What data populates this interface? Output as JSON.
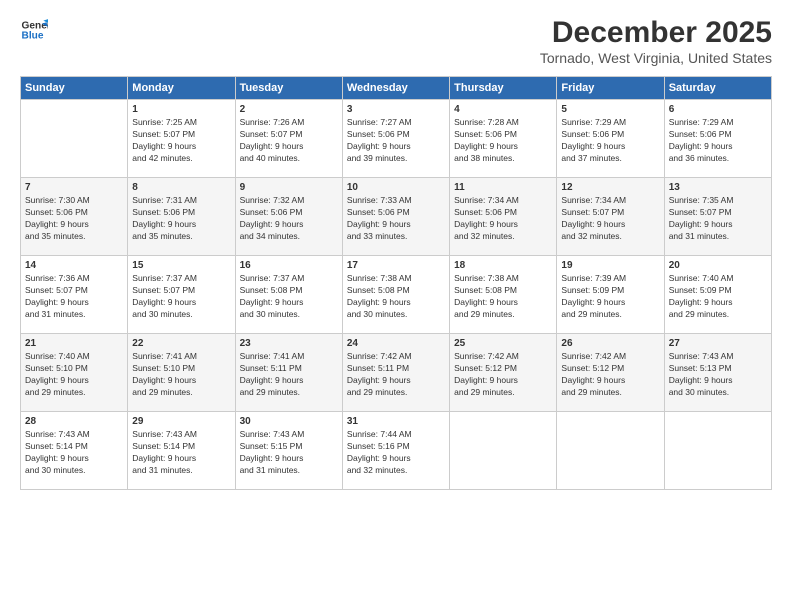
{
  "logo": {
    "line1": "General",
    "line2": "Blue"
  },
  "title": "December 2025",
  "subtitle": "Tornado, West Virginia, United States",
  "header_days": [
    "Sunday",
    "Monday",
    "Tuesday",
    "Wednesday",
    "Thursday",
    "Friday",
    "Saturday"
  ],
  "weeks": [
    [
      {
        "num": "",
        "detail": ""
      },
      {
        "num": "1",
        "detail": "Sunrise: 7:25 AM\nSunset: 5:07 PM\nDaylight: 9 hours\nand 42 minutes."
      },
      {
        "num": "2",
        "detail": "Sunrise: 7:26 AM\nSunset: 5:07 PM\nDaylight: 9 hours\nand 40 minutes."
      },
      {
        "num": "3",
        "detail": "Sunrise: 7:27 AM\nSunset: 5:06 PM\nDaylight: 9 hours\nand 39 minutes."
      },
      {
        "num": "4",
        "detail": "Sunrise: 7:28 AM\nSunset: 5:06 PM\nDaylight: 9 hours\nand 38 minutes."
      },
      {
        "num": "5",
        "detail": "Sunrise: 7:29 AM\nSunset: 5:06 PM\nDaylight: 9 hours\nand 37 minutes."
      },
      {
        "num": "6",
        "detail": "Sunrise: 7:29 AM\nSunset: 5:06 PM\nDaylight: 9 hours\nand 36 minutes."
      }
    ],
    [
      {
        "num": "7",
        "detail": "Sunrise: 7:30 AM\nSunset: 5:06 PM\nDaylight: 9 hours\nand 35 minutes."
      },
      {
        "num": "8",
        "detail": "Sunrise: 7:31 AM\nSunset: 5:06 PM\nDaylight: 9 hours\nand 35 minutes."
      },
      {
        "num": "9",
        "detail": "Sunrise: 7:32 AM\nSunset: 5:06 PM\nDaylight: 9 hours\nand 34 minutes."
      },
      {
        "num": "10",
        "detail": "Sunrise: 7:33 AM\nSunset: 5:06 PM\nDaylight: 9 hours\nand 33 minutes."
      },
      {
        "num": "11",
        "detail": "Sunrise: 7:34 AM\nSunset: 5:06 PM\nDaylight: 9 hours\nand 32 minutes."
      },
      {
        "num": "12",
        "detail": "Sunrise: 7:34 AM\nSunset: 5:07 PM\nDaylight: 9 hours\nand 32 minutes."
      },
      {
        "num": "13",
        "detail": "Sunrise: 7:35 AM\nSunset: 5:07 PM\nDaylight: 9 hours\nand 31 minutes."
      }
    ],
    [
      {
        "num": "14",
        "detail": "Sunrise: 7:36 AM\nSunset: 5:07 PM\nDaylight: 9 hours\nand 31 minutes."
      },
      {
        "num": "15",
        "detail": "Sunrise: 7:37 AM\nSunset: 5:07 PM\nDaylight: 9 hours\nand 30 minutes."
      },
      {
        "num": "16",
        "detail": "Sunrise: 7:37 AM\nSunset: 5:08 PM\nDaylight: 9 hours\nand 30 minutes."
      },
      {
        "num": "17",
        "detail": "Sunrise: 7:38 AM\nSunset: 5:08 PM\nDaylight: 9 hours\nand 30 minutes."
      },
      {
        "num": "18",
        "detail": "Sunrise: 7:38 AM\nSunset: 5:08 PM\nDaylight: 9 hours\nand 29 minutes."
      },
      {
        "num": "19",
        "detail": "Sunrise: 7:39 AM\nSunset: 5:09 PM\nDaylight: 9 hours\nand 29 minutes."
      },
      {
        "num": "20",
        "detail": "Sunrise: 7:40 AM\nSunset: 5:09 PM\nDaylight: 9 hours\nand 29 minutes."
      }
    ],
    [
      {
        "num": "21",
        "detail": "Sunrise: 7:40 AM\nSunset: 5:10 PM\nDaylight: 9 hours\nand 29 minutes."
      },
      {
        "num": "22",
        "detail": "Sunrise: 7:41 AM\nSunset: 5:10 PM\nDaylight: 9 hours\nand 29 minutes."
      },
      {
        "num": "23",
        "detail": "Sunrise: 7:41 AM\nSunset: 5:11 PM\nDaylight: 9 hours\nand 29 minutes."
      },
      {
        "num": "24",
        "detail": "Sunrise: 7:42 AM\nSunset: 5:11 PM\nDaylight: 9 hours\nand 29 minutes."
      },
      {
        "num": "25",
        "detail": "Sunrise: 7:42 AM\nSunset: 5:12 PM\nDaylight: 9 hours\nand 29 minutes."
      },
      {
        "num": "26",
        "detail": "Sunrise: 7:42 AM\nSunset: 5:12 PM\nDaylight: 9 hours\nand 29 minutes."
      },
      {
        "num": "27",
        "detail": "Sunrise: 7:43 AM\nSunset: 5:13 PM\nDaylight: 9 hours\nand 30 minutes."
      }
    ],
    [
      {
        "num": "28",
        "detail": "Sunrise: 7:43 AM\nSunset: 5:14 PM\nDaylight: 9 hours\nand 30 minutes."
      },
      {
        "num": "29",
        "detail": "Sunrise: 7:43 AM\nSunset: 5:14 PM\nDaylight: 9 hours\nand 31 minutes."
      },
      {
        "num": "30",
        "detail": "Sunrise: 7:43 AM\nSunset: 5:15 PM\nDaylight: 9 hours\nand 31 minutes."
      },
      {
        "num": "31",
        "detail": "Sunrise: 7:44 AM\nSunset: 5:16 PM\nDaylight: 9 hours\nand 32 minutes."
      },
      {
        "num": "",
        "detail": ""
      },
      {
        "num": "",
        "detail": ""
      },
      {
        "num": "",
        "detail": ""
      }
    ]
  ]
}
